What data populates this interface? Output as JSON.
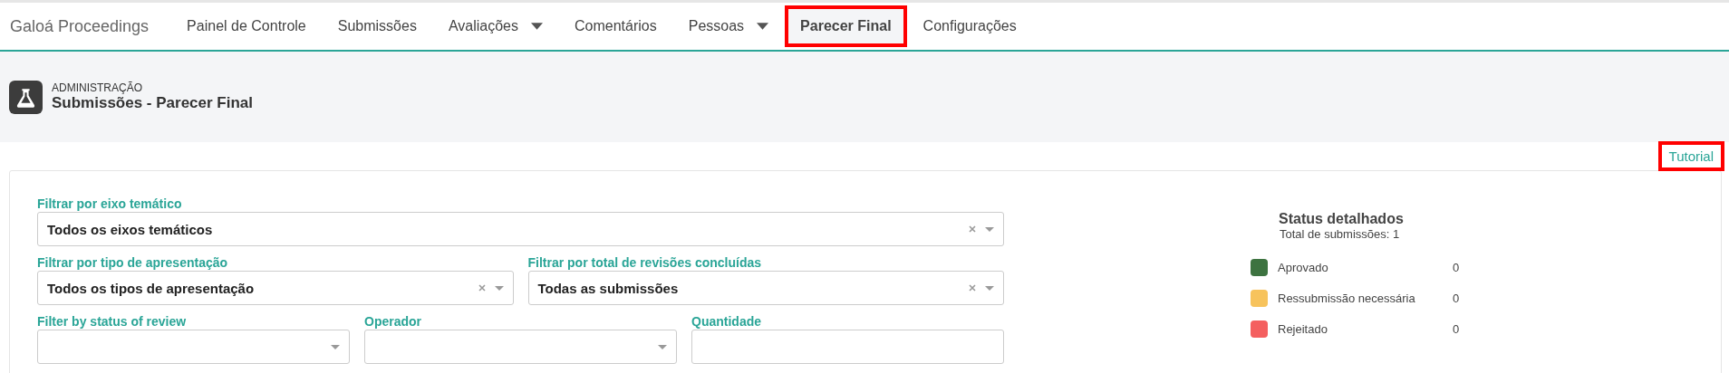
{
  "brand": "Galoá Proceedings",
  "nav": [
    {
      "label": "Painel de Controle",
      "dropdown": false,
      "selected": false,
      "highlighted": false
    },
    {
      "label": "Submissões",
      "dropdown": false,
      "selected": false,
      "highlighted": false
    },
    {
      "label": "Avaliações",
      "dropdown": true,
      "selected": false,
      "highlighted": false
    },
    {
      "label": "Comentários",
      "dropdown": false,
      "selected": false,
      "highlighted": false
    },
    {
      "label": "Pessoas",
      "dropdown": true,
      "selected": false,
      "highlighted": false
    },
    {
      "label": "Parecer Final",
      "dropdown": false,
      "selected": true,
      "highlighted": true
    },
    {
      "label": "Configurações",
      "dropdown": false,
      "selected": false,
      "highlighted": false
    }
  ],
  "header": {
    "section": "ADMINISTRAÇÃO",
    "title": "Submissões - Parecer Final"
  },
  "tutorial": {
    "label": "Tutorial",
    "highlighted": true
  },
  "filter_rows": [
    [
      {
        "label": "Filtrar por eixo temático",
        "value": "Todos os eixos temáticos",
        "kind": "select",
        "clearable": true
      }
    ],
    [
      {
        "label": "Filtrar por tipo de apresentação",
        "value": "Todos os tipos de apresentação",
        "kind": "select",
        "clearable": true
      },
      {
        "label": "Filtrar por total de revisões concluídas",
        "value": "Todas as submissões",
        "kind": "select",
        "clearable": true
      }
    ],
    [
      {
        "label": "Filter by status of review",
        "kind": "select",
        "clearable": false
      },
      {
        "label": "Operador",
        "kind": "select",
        "clearable": false
      },
      {
        "label": "Quantidade",
        "kind": "input"
      }
    ]
  ],
  "status": {
    "title": "Status detalhados",
    "subtitle": "Total de submissões: 1",
    "items": [
      {
        "label": "Aprovado",
        "count": "0",
        "color": "#3d7340"
      },
      {
        "label": "Ressubmissão necessária",
        "count": "0",
        "color": "#f7c35c"
      },
      {
        "label": "Rejeitado",
        "count": "0",
        "color": "#f45f5f"
      }
    ]
  }
}
